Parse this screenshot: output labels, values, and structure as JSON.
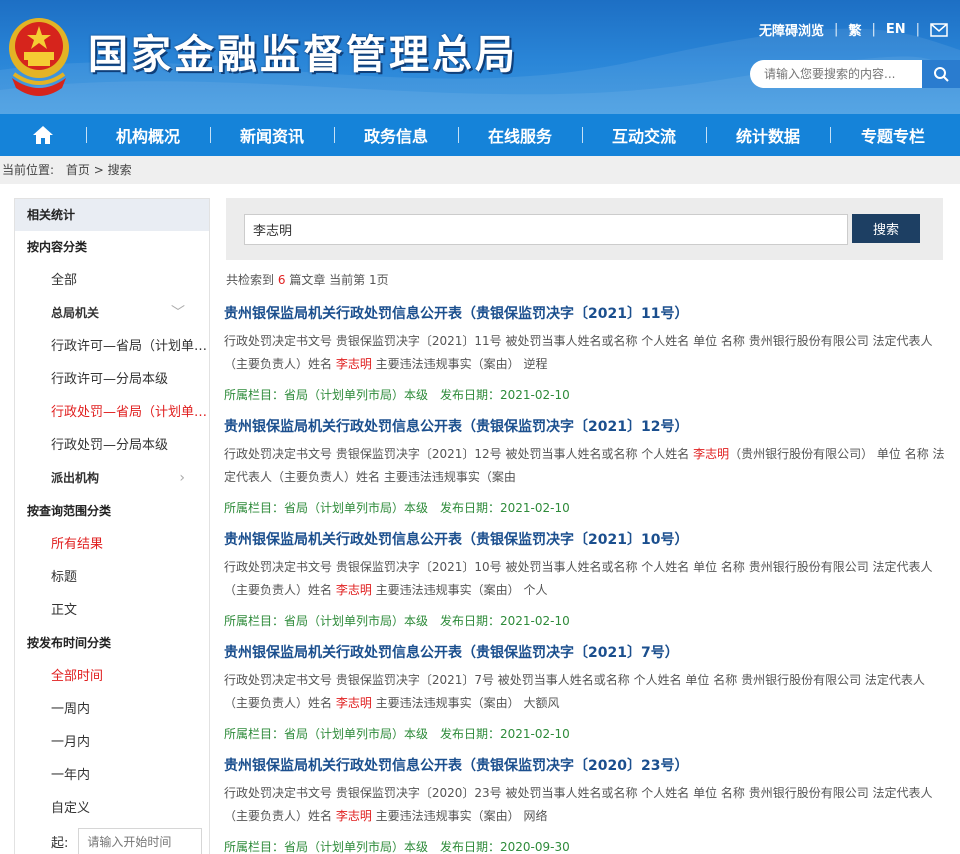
{
  "header": {
    "site_title": "国家金融监督管理总局",
    "toplinks": {
      "accessible": "无障碍浏览",
      "traditional": "繁",
      "english": "EN"
    },
    "search_placeholder": "请输入您要搜索的内容..."
  },
  "nav": {
    "items": [
      "机构概况",
      "新闻资讯",
      "政务信息",
      "在线服务",
      "互动交流",
      "统计数据",
      "专题专栏"
    ]
  },
  "breadcrumb": {
    "label": "当前位置:",
    "home": "首页",
    "sep": ">",
    "current": "搜索"
  },
  "sidebar": {
    "heading": "相关统计",
    "content_group": "按内容分类",
    "content_items": [
      {
        "label": "全部"
      },
      {
        "label": "总局机关",
        "arrow": "﹀"
      },
      {
        "label": "行政许可—省局（计划单列市局）"
      },
      {
        "label": "行政许可—分局本级"
      },
      {
        "label": "行政处罚—省局（计划单列市局）"
      },
      {
        "label": "行政处罚—分局本级"
      },
      {
        "label": "派出机构",
        "arrow": "›"
      }
    ],
    "scope_group": "按查询范围分类",
    "scope_items": [
      "所有结果",
      "标题",
      "正文"
    ],
    "time_group": "按发布时间分类",
    "time_items": [
      "全部时间",
      "一周内",
      "一月内",
      "一年内",
      "自定义"
    ],
    "start_label": "起:",
    "start_placeholder": "请输入开始时间"
  },
  "search": {
    "value": "李志明",
    "button": "搜索"
  },
  "summary": {
    "prefix": "共检索到",
    "count": "6",
    "middle": "篇文章 当前第",
    "page": "1",
    "suffix": "页"
  },
  "results": [
    {
      "title": "贵州银保监局机关行政处罚信息公开表（贵银保监罚决字〔2021〕11号）",
      "desc_before": "行政处罚决定书文号 贵银保监罚决字〔2021〕11号 被处罚当事人姓名或名称 个人姓名 单位 名称 贵州银行股份有限公司 法定代表人（主要负责人）姓名 ",
      "highlight": "李志明",
      "desc_after": " 主要违法违规事实（案由） 逆程",
      "column": "所属栏目：省局（计划单列市局）本级",
      "date": "发布日期：2021-02-10"
    },
    {
      "title": "贵州银保监局机关行政处罚信息公开表（贵银保监罚决字〔2021〕12号）",
      "desc_before": "行政处罚决定书文号 贵银保监罚决字〔2021〕12号 被处罚当事人姓名或名称 个人姓名 ",
      "highlight": "李志明",
      "desc_after": "（贵州银行股份有限公司） 单位 名称 法定代表人（主要负责人）姓名 主要违法违规事实（案由",
      "column": "所属栏目：省局（计划单列市局）本级",
      "date": "发布日期：2021-02-10"
    },
    {
      "title": "贵州银保监局机关行政处罚信息公开表（贵银保监罚决字〔2021〕10号）",
      "desc_before": "行政处罚决定书文号 贵银保监罚决字〔2021〕10号 被处罚当事人姓名或名称 个人姓名 单位 名称 贵州银行股份有限公司 法定代表人（主要负责人）姓名 ",
      "highlight": "李志明",
      "desc_after": " 主要违法违规事实（案由） 个人",
      "column": "所属栏目：省局（计划单列市局）本级",
      "date": "发布日期：2021-02-10"
    },
    {
      "title": "贵州银保监局机关行政处罚信息公开表（贵银保监罚决字〔2021〕7号）",
      "desc_before": "行政处罚决定书文号 贵银保监罚决字〔2021〕7号 被处罚当事人姓名或名称 个人姓名 单位 名称 贵州银行股份有限公司 法定代表人（主要负责人）姓名 ",
      "highlight": "李志明",
      "desc_after": " 主要违法违规事实（案由） 大额风",
      "column": "所属栏目：省局（计划单列市局）本级",
      "date": "发布日期：2021-02-10"
    },
    {
      "title": "贵州银保监局机关行政处罚信息公开表（贵银保监罚决字〔2020〕23号）",
      "desc_before": "行政处罚决定书文号 贵银保监罚决字〔2020〕23号 被处罚当事人姓名或名称 个人姓名 单位 名称 贵州银行股份有限公司 法定代表人（主要负责人）姓名 ",
      "highlight": "李志明",
      "desc_after": " 主要违法违规事实（案由） 网络",
      "column": "所属栏目：省局（计划单列市局）本级",
      "date": "发布日期：2020-09-30"
    }
  ],
  "colors": {
    "nav": "#1583d9",
    "title": "#1b4f8e",
    "highlight": "#e02020",
    "meta": "#2e8b3a",
    "button": "#1d3f63"
  }
}
